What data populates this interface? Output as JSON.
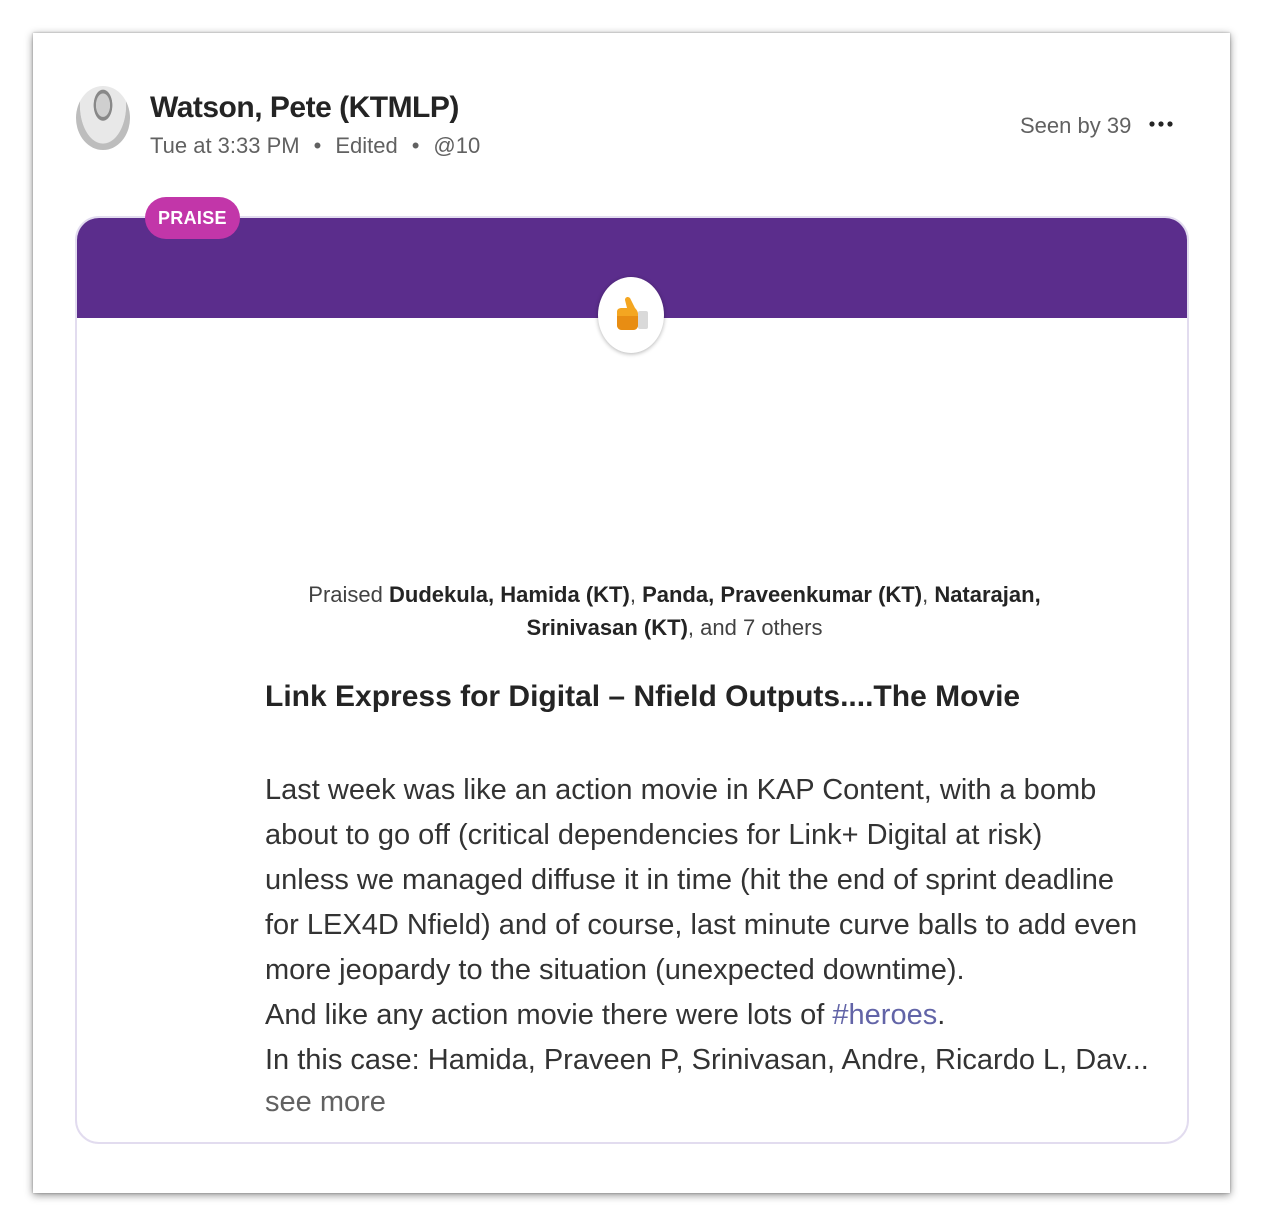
{
  "post": {
    "author": "Watson, Pete (KTMLP)",
    "time": "Tue at 3:33 PM",
    "edited": "Edited",
    "mention": "@10",
    "separator": "•",
    "seen_by": "Seen by 39",
    "more_icon": "ellipsis-icon"
  },
  "praise": {
    "badge": "PRAISE",
    "icon": "thumbs-up-icon",
    "praised_prefix": "Praised",
    "recipient_1": "Dudekula, Hamida (KT)",
    "recipient_2": "Panda, Praveenkumar (KT)",
    "recipient_3": "Natarajan, Srinivasan (KT)",
    "comma": ",",
    "others": "and 7 others",
    "title": "Link Express for Digital – Nfield Outputs....The Movie",
    "body_lines": [
      "Last week was like an action movie in KAP Content, with a bomb",
      "about to go off (critical dependencies for Link+ Digital at risk)",
      "unless we managed diffuse it in time (hit the end of sprint deadline",
      "for LEX4D Nfield) and of course, last minute curve balls to add even",
      "more jeopardy to the situation (unexpected downtime)."
    ],
    "line6_text": "And like any action movie there were lots of",
    "hashtag": "#heroes",
    "period": ".",
    "line7": "In this case: Hamida, Praveen P, Srinivasan, Andre,  Ricardo L, Dav...",
    "see_more": "see more",
    "more_recipients": "+7"
  },
  "colors": {
    "banner": "#5b2d8c",
    "badge": "#c236a9",
    "hashtag": "#6264a7"
  }
}
